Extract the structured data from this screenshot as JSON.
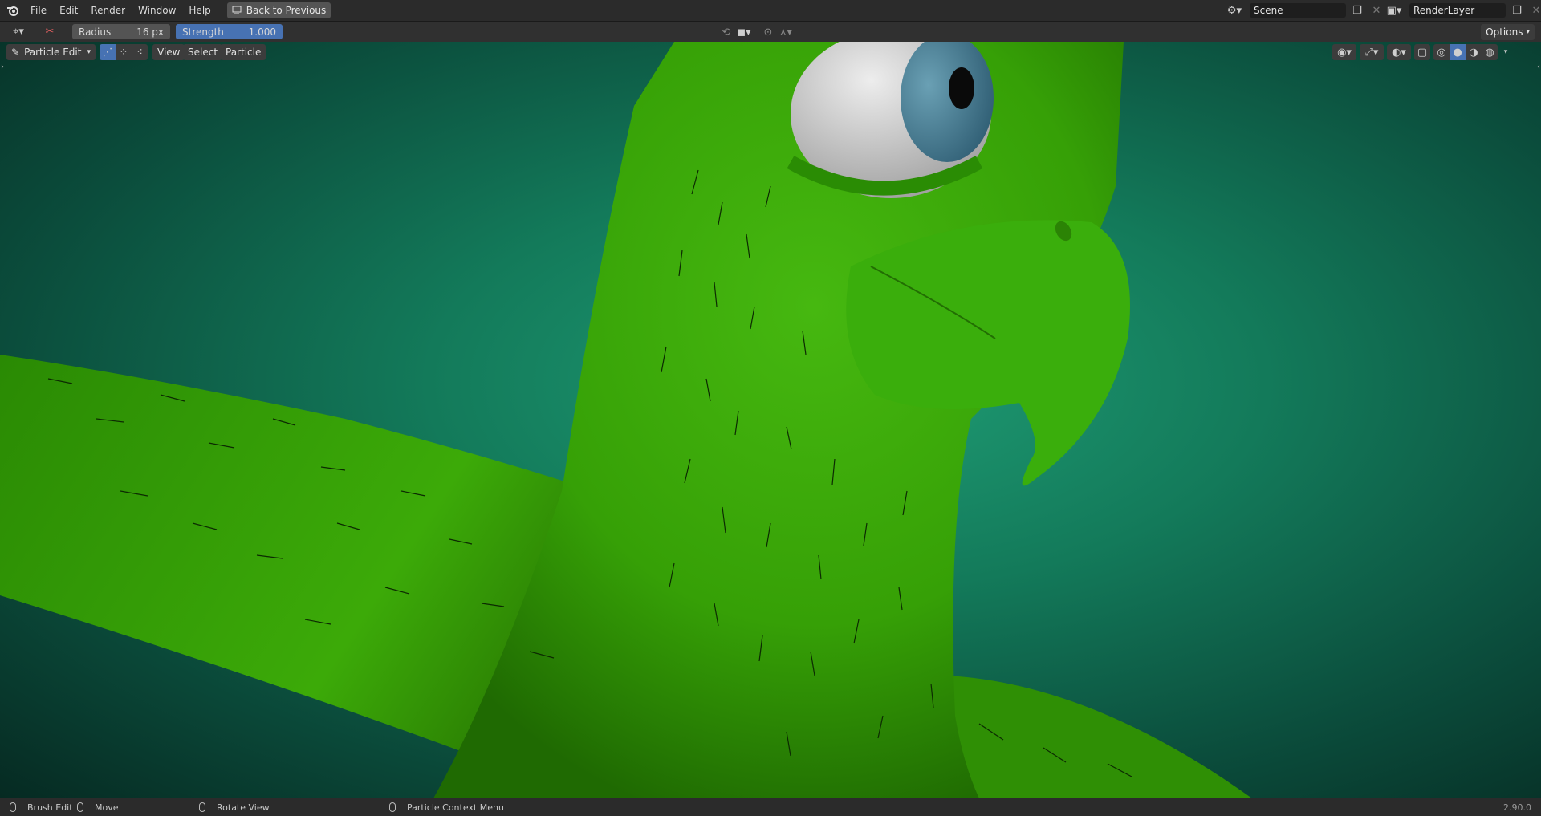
{
  "topbar": {
    "menus": [
      "File",
      "Edit",
      "Render",
      "Window",
      "Help"
    ],
    "back_button": "Back to Previous",
    "scene": "Scene",
    "render_layer": "RenderLayer"
  },
  "toolheader": {
    "radius_label": "Radius",
    "radius_value": "16 px",
    "strength_label": "Strength",
    "strength_value": "1.000",
    "strength_fraction": 1.0,
    "options_label": "Options"
  },
  "viewport_header": {
    "mode": "Particle Edit",
    "menus": [
      "View",
      "Select",
      "Particle"
    ]
  },
  "statusbar": {
    "brush_edit": "Brush Edit",
    "move": "Move",
    "rotate_view": "Rotate View",
    "context_menu": "Particle Context Menu",
    "version": "2.90.0"
  },
  "colors": {
    "accent": "#4772b3",
    "bird_green": "#3aa80a",
    "background_teal": "#1f9c74"
  },
  "icons": [
    "blender-logo-icon",
    "back-icon",
    "scene-icon",
    "render-layer-icon",
    "comb-brush-icon",
    "x-brush-icon",
    "snap-icon",
    "overlay-icon",
    "shading-icon",
    "visibility-icon",
    "gizmo-icon"
  ]
}
